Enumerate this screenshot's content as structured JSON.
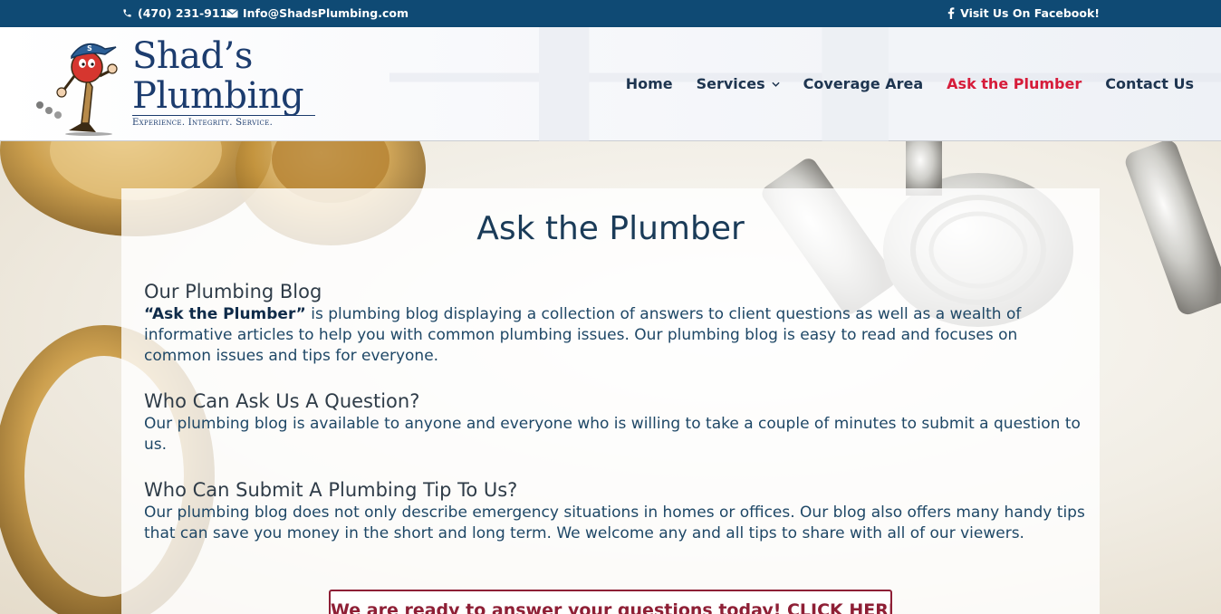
{
  "topbar": {
    "phone": "(470) 231-9110",
    "email": "Info@ShadsPlumbing.com",
    "facebook": "Visit Us On Facebook!"
  },
  "logo": {
    "line1": "Shad’s",
    "line2": "Plumbing",
    "tagline": "Experience. Integrity. Service."
  },
  "nav": {
    "home": "Home",
    "services": "Services",
    "coverage": "Coverage Area",
    "ask": "Ask the Plumber",
    "contact": "Contact Us",
    "active_color": "#d61c3a"
  },
  "main": {
    "title": "Ask the Plumber",
    "sections": [
      {
        "heading": "Our Plumbing Blog",
        "lead": "“Ask the Plumber”",
        "body": " is plumbing blog displaying a collection of answers to client questions as well as a wealth of informative articles to help you with common plumbing issues. Our plumbing blog is easy to read and focuses on common issues and tips for everyone."
      },
      {
        "heading": "Who Can Ask Us A Question?",
        "body": "Our plumbing blog is available to anyone and everyone who is willing to take a couple of minutes to submit a question to us."
      },
      {
        "heading": "Who Can Submit A Plumbing Tip To Us?",
        "body": "Our plumbing blog does not only describe emergency situations in homes or offices. Our blog also offers many handy tips that can save you money in the short and long term. We welcome any and all tips to share with all of our viewers."
      }
    ],
    "cta": "We are ready to answer your questions today! CLICK HERE"
  },
  "colors": {
    "topbar_bg": "#0f4a74",
    "brand_navy": "#1c3c6e",
    "cta": "#8e1f35"
  }
}
